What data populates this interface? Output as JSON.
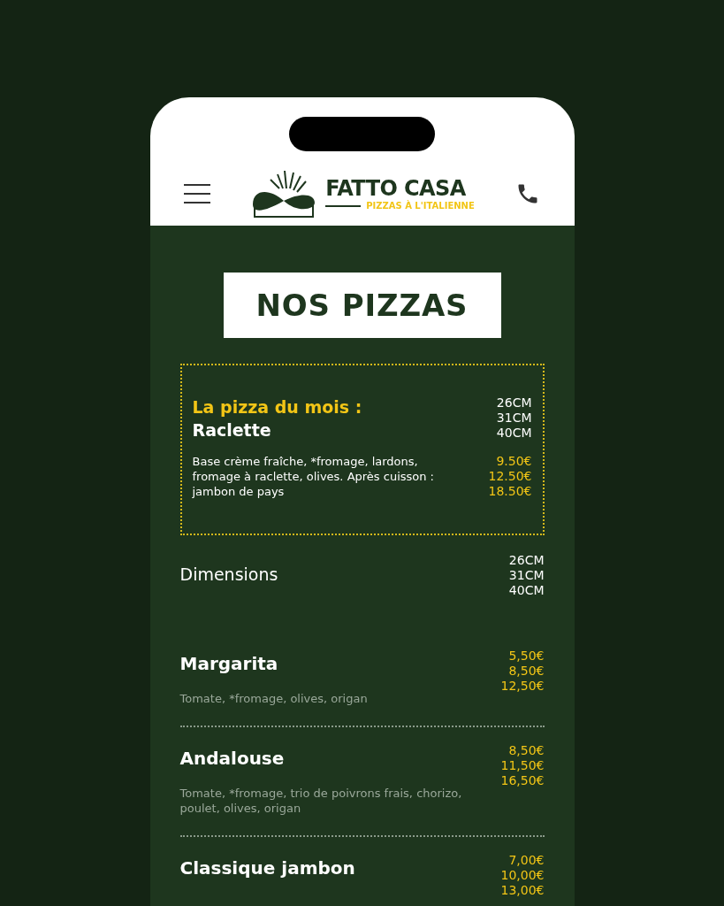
{
  "header": {
    "brand": "FATTO CASA",
    "tagline": "PIZZAS À L'ITALIENNE"
  },
  "heading": "NOS PIZZAS",
  "featured": {
    "label": "La pizza du mois :",
    "name": "Raclette",
    "description": "Base crème fraîche, *fromage, lardons, fromage à raclette, olives. Après cuisson : jambon de pays",
    "sizes": [
      "26CM",
      "31CM",
      "40CM"
    ],
    "prices": [
      "9.50€",
      "12.50€",
      "18.50€"
    ]
  },
  "dimensions": {
    "label": "Dimensions",
    "sizes": [
      "26CM",
      "31CM",
      "40CM"
    ]
  },
  "pizzas": [
    {
      "name": "Margarita",
      "description": "Tomate, *fromage, olives, origan",
      "prices": [
        "5,50€",
        "8,50€",
        "12,50€"
      ]
    },
    {
      "name": "Andalouse",
      "description": "Tomate, *fromage, trio de poivrons frais, chorizo, poulet, olives, origan",
      "prices": [
        "8,50€",
        "11,50€",
        "16,50€"
      ]
    },
    {
      "name": "Classique jambon",
      "prices": [
        "7,00€",
        "10,00€",
        "13,00€"
      ]
    }
  ]
}
